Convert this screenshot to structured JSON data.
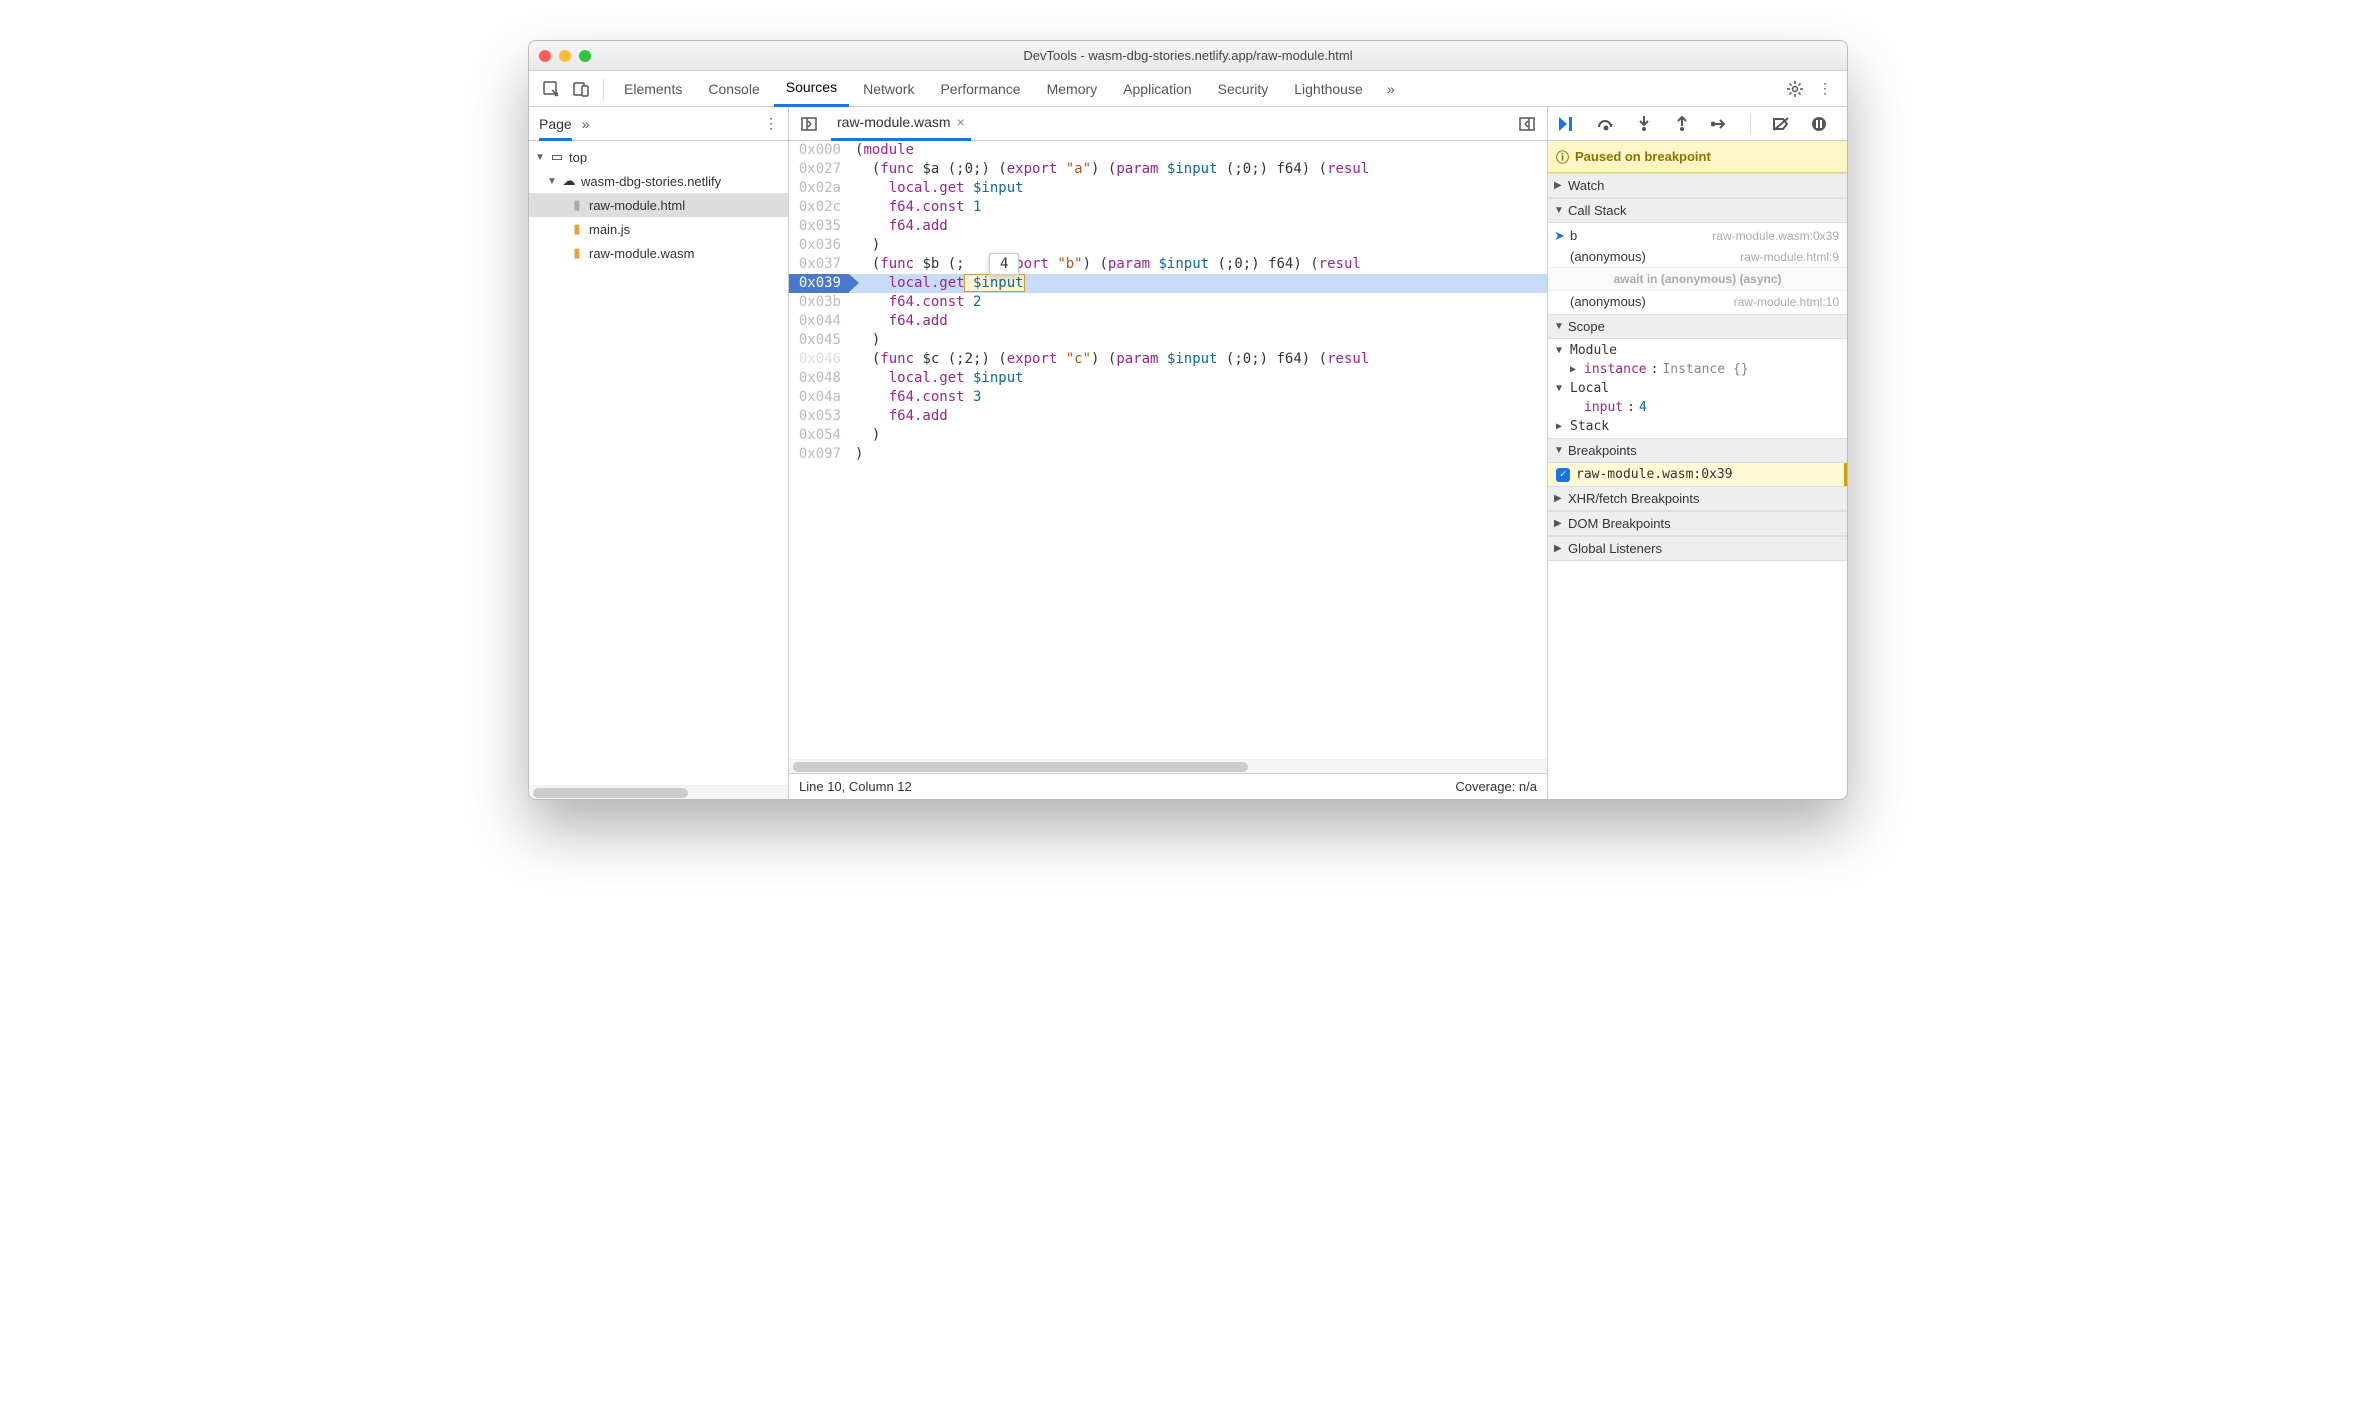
{
  "window": {
    "title": "DevTools - wasm-dbg-stories.netlify.app/raw-module.html"
  },
  "tabs": [
    "Elements",
    "Console",
    "Sources",
    "Network",
    "Performance",
    "Memory",
    "Application",
    "Security",
    "Lighthouse"
  ],
  "active_tab": "Sources",
  "sidebar": {
    "tab": "Page",
    "tree": {
      "top": "top",
      "domain": "wasm-dbg-stories.netlify",
      "files": [
        "raw-module.html",
        "main.js",
        "raw-module.wasm"
      ]
    }
  },
  "editor": {
    "file": "raw-module.wasm",
    "status_left": "Line 10, Column 12",
    "status_right": "Coverage: n/a",
    "hover_value": "4",
    "lines": [
      {
        "addr": "0x000",
        "t": "(",
        "k": "module"
      },
      {
        "addr": "0x027",
        "t": "  (",
        "k": "func",
        "rest": " $a (;0;) (",
        "k2": "export",
        "str": " \"a\"",
        "rest2": ") (",
        "k3": "param",
        "var": " $input",
        "rest3": " (;0;) f64) (",
        "k4": "resul"
      },
      {
        "addr": "0x02a",
        "t": "    ",
        "k": "local.get",
        "var": " $input"
      },
      {
        "addr": "0x02c",
        "t": "    ",
        "k": "f64.const",
        "num": " 1"
      },
      {
        "addr": "0x035",
        "t": "    ",
        "k": "f64.add"
      },
      {
        "addr": "0x036",
        "t": "  )"
      },
      {
        "addr": "0x037",
        "t": "  (",
        "k": "func",
        "rest": " $b (;   (",
        "k2": "export",
        "str": " \"b\"",
        "rest2": ") (",
        "k3": "param",
        "var": " $input",
        "rest3": " (;0;) f64) (",
        "k4": "resul"
      },
      {
        "addr": "0x039",
        "t": "    ",
        "k": "local.get",
        "var": " $input",
        "cur": true
      },
      {
        "addr": "0x03b",
        "t": "    ",
        "k": "f64.const",
        "num": " 2"
      },
      {
        "addr": "0x044",
        "t": "    ",
        "k": "f64.add"
      },
      {
        "addr": "0x045",
        "t": "  )"
      },
      {
        "addr": "0x046",
        "t": "  (",
        "k": "func",
        "rest": " $c (;2;) (",
        "k2": "export",
        "str": " \"c\"",
        "rest2": ") (",
        "k3": "param",
        "var": " $input",
        "rest3": " (;0;) f64) (",
        "k4": "resul",
        "dim": true
      },
      {
        "addr": "0x048",
        "t": "    ",
        "k": "local.get",
        "var": " $input"
      },
      {
        "addr": "0x04a",
        "t": "    ",
        "k": "f64.const",
        "num": " 3"
      },
      {
        "addr": "0x053",
        "t": "    ",
        "k": "f64.add"
      },
      {
        "addr": "0x054",
        "t": "  )"
      },
      {
        "addr": "0x097",
        "t": ")"
      }
    ]
  },
  "debugger": {
    "paused": "Paused on breakpoint",
    "sections": {
      "watch": "Watch",
      "callstack": "Call Stack",
      "scope": "Scope",
      "breakpoints": "Breakpoints",
      "xhr": "XHR/fetch Breakpoints",
      "dom": "DOM Breakpoints",
      "global": "Global Listeners"
    },
    "callstack": [
      {
        "fn": "b",
        "loc": "raw-module.wasm:0x39",
        "current": true
      },
      {
        "fn": "(anonymous)",
        "loc": "raw-module.html:9"
      },
      {
        "async": "await in (anonymous) (async)"
      },
      {
        "fn": "(anonymous)",
        "loc": "raw-module.html:10"
      }
    ],
    "scope": {
      "module": {
        "label": "Module",
        "prop": "instance",
        "val": "Instance {}"
      },
      "local": {
        "label": "Local",
        "prop": "input",
        "val": "4"
      },
      "stack": "Stack"
    },
    "breakpoint": "raw-module.wasm:0x39"
  }
}
